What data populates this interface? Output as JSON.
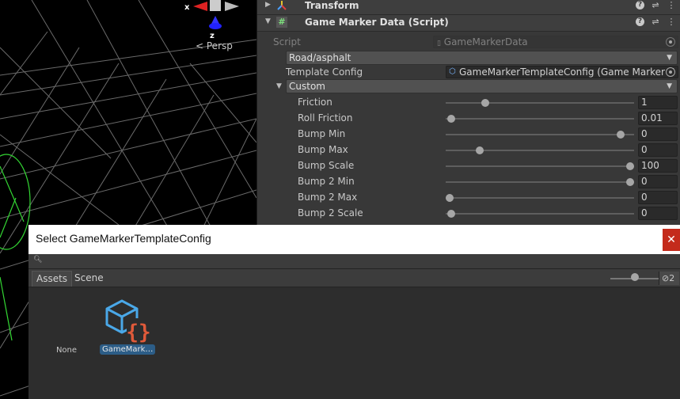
{
  "scene": {
    "gizmo_x": "x",
    "gizmo_z": "z",
    "persp_label": "Persp"
  },
  "inspector": {
    "transform": {
      "title": "Transform"
    },
    "component": {
      "title": "Game Marker Data (Script)",
      "script_label": "Script",
      "script_value": "GameMarkerData",
      "surface_dropdown": "Road/asphalt",
      "template_label": "Template Config",
      "template_value": "GameMarkerTemplateConfig (Game Marker T",
      "custom_dropdown": "Custom"
    },
    "sliders": [
      {
        "label": "Friction",
        "value": "1",
        "fraction": 0.21
      },
      {
        "label": "Roll Friction",
        "value": "0.01",
        "fraction": 0.03
      },
      {
        "label": "Bump Min",
        "value": "0",
        "fraction": 0.93
      },
      {
        "label": "Bump Max",
        "value": "0",
        "fraction": 0.18
      },
      {
        "label": "Bump Scale",
        "value": "100",
        "fraction": 0.98
      },
      {
        "label": "Bump 2 Min",
        "value": "0",
        "fraction": 0.98
      },
      {
        "label": "Bump 2 Max",
        "value": "0",
        "fraction": 0.02
      },
      {
        "label": "Bump 2 Scale",
        "value": "0",
        "fraction": 0.03
      }
    ]
  },
  "picker": {
    "title": "Select GameMarkerTemplateConfig",
    "close_label": "✕",
    "tabs": [
      "Assets",
      "Scene"
    ],
    "hidden_count": "2",
    "zoom_fraction": 0.5,
    "items": [
      {
        "label": "None"
      },
      {
        "label": "GameMark…"
      }
    ]
  }
}
